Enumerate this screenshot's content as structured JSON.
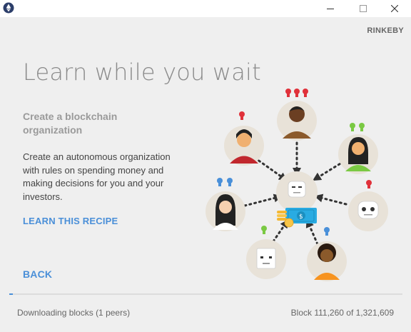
{
  "titlebar": {
    "app_icon": "ethereum-icon",
    "controls": [
      "minimize-icon",
      "maximize-icon",
      "close-icon"
    ]
  },
  "network": "RINKEBY",
  "headline": "Learn while you wait",
  "recipe": {
    "title": "Create a blockchain organization",
    "description": "Create an autonomous organization with rules on spending money and making decisions for you and your investors.",
    "learn_label": "LEARN THIS RECIPE"
  },
  "back_label": "BACK",
  "status": {
    "downloading": "Downloading blocks (1 peers)",
    "block": "Block 111,260 of 1,321,609",
    "progress": 0.0084
  },
  "illustration": {
    "icons": [
      "robot-icon",
      "money-icon",
      "coins-icon",
      "person-avatar-icon",
      "lightbulb-icon"
    ],
    "colors": {
      "bulb_red": "#e0313a",
      "bulb_green": "#7ac943",
      "bulb_blue": "#4a90d9",
      "circle_bg": "#e8e2d8",
      "money": "#29abe2"
    }
  }
}
